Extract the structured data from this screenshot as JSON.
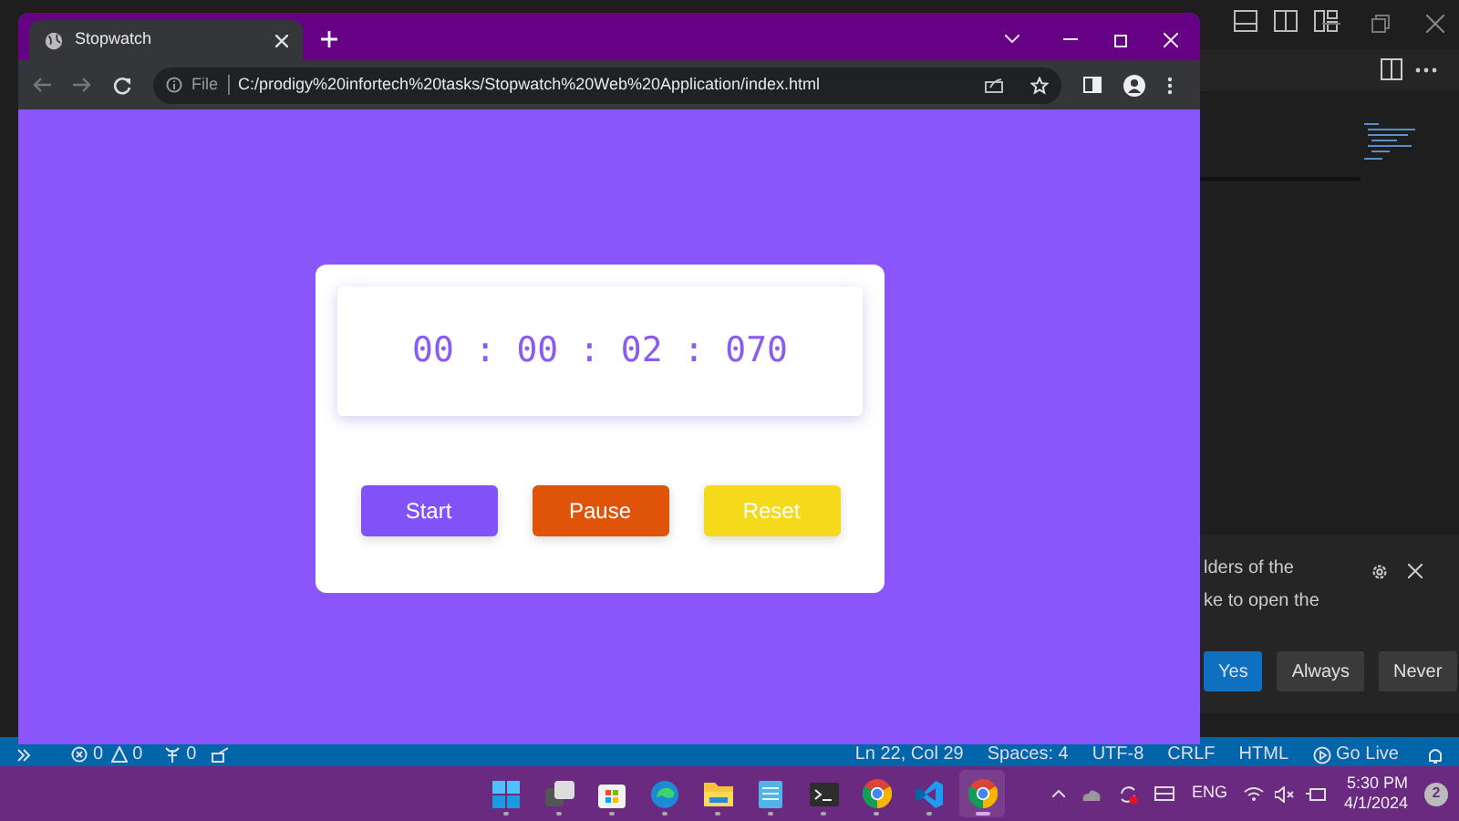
{
  "browser": {
    "tab": {
      "title": "Stopwatch"
    },
    "address": {
      "scheme_label": "File",
      "url": "C:/prodigy%20infortech%20tasks/Stopwatch%20Web%20Application/index.html"
    }
  },
  "stopwatch": {
    "display": "00 : 00 : 02 : 070",
    "buttons": [
      {
        "label": "Start",
        "color": "#8052f7"
      },
      {
        "label": "Pause",
        "color": "#e0540a"
      },
      {
        "label": "Reset",
        "color": "#f5d91b"
      }
    ]
  },
  "editor_status_bar": {
    "errors": "0",
    "warnings": "0",
    "ports": "0",
    "items": [
      "Ln 22, Col 29",
      "Spaces: 4",
      "UTF-8",
      "CRLF",
      "HTML"
    ],
    "go_live": "Go Live"
  },
  "notification": {
    "lines": [
      "lders of the",
      "ke to open the"
    ],
    "buttons": [
      {
        "label": "Yes",
        "primary": true
      },
      {
        "label": "Always",
        "primary": false
      },
      {
        "label": "Never",
        "primary": false
      }
    ]
  },
  "taskbar": {
    "apps": [
      {
        "kind": "start",
        "selected": false
      },
      {
        "kind": "task-view",
        "selected": false
      },
      {
        "kind": "store",
        "selected": false
      },
      {
        "kind": "edge",
        "selected": false
      },
      {
        "kind": "explorer",
        "selected": false
      },
      {
        "kind": "notepad",
        "selected": false
      },
      {
        "kind": "terminal",
        "selected": false
      },
      {
        "kind": "chrome",
        "selected": false
      },
      {
        "kind": "vscode",
        "selected": false
      },
      {
        "kind": "chrome",
        "selected": true
      }
    ],
    "language": "ENG",
    "time": "5:30 PM",
    "date": "4/1/2024",
    "notification_count": "2"
  }
}
